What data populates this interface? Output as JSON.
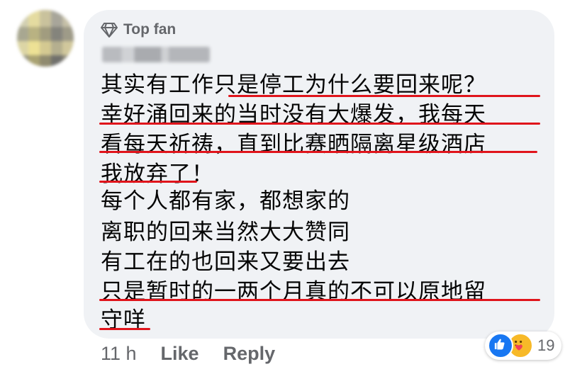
{
  "comment": {
    "badge": "Top fan",
    "lines": [
      "其实有工作只是停工为什么要回来呢？",
      "幸好涌回来的当时没有大爆发，我每天",
      "看每天祈祷，直到比赛晒隔离星级酒店",
      "我放弃了！",
      "每个人都有家，都想家的",
      "离职的回来当然大大赞同",
      "有工在的也回来又要出去",
      "只是暂时的一两个月真的不可以原地留",
      "守咩"
    ]
  },
  "footer": {
    "time": "11 h",
    "like": "Like",
    "reply": "Reply"
  },
  "reactions": {
    "icons": [
      "like-icon",
      "care-icon"
    ],
    "count": "19"
  },
  "colors": {
    "bubble": "#f0f2f5",
    "text": "#050505",
    "secondary": "#65676b",
    "underline": "#e0141b",
    "like_blue": "#1877f2",
    "care_yellow": "#f7b928"
  }
}
